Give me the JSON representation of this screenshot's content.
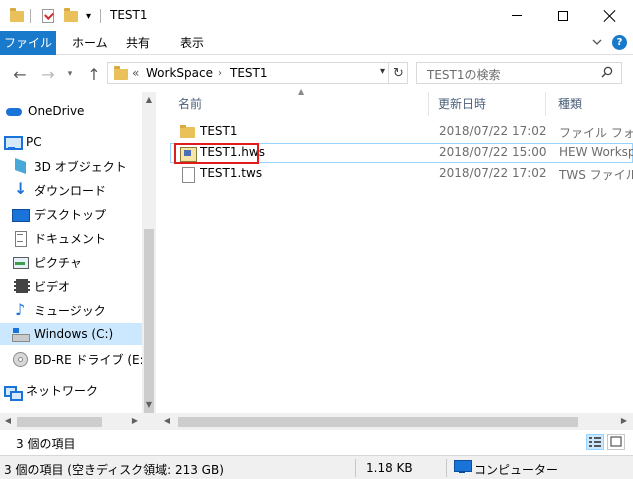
{
  "window": {
    "title": "TEST1"
  },
  "ribbon": {
    "tabs": [
      "ファイル",
      "ホーム",
      "共有",
      "表示"
    ]
  },
  "address": {
    "prefix": "«",
    "crumbs": [
      "WorkSpace",
      "TEST1"
    ]
  },
  "search": {
    "placeholder": "TEST1の検索"
  },
  "nav": {
    "items": [
      {
        "label": "OneDrive",
        "icon": "cloud-icon"
      },
      {
        "label": "PC",
        "icon": "pc-icon"
      },
      {
        "label": "3D オブジェクト",
        "icon": "cube-icon"
      },
      {
        "label": "ダウンロード",
        "icon": "download-icon"
      },
      {
        "label": "デスクトップ",
        "icon": "desktop-icon"
      },
      {
        "label": "ドキュメント",
        "icon": "document-icon"
      },
      {
        "label": "ピクチャ",
        "icon": "picture-icon"
      },
      {
        "label": "ビデオ",
        "icon": "video-icon"
      },
      {
        "label": "ミュージック",
        "icon": "music-icon"
      },
      {
        "label": "Windows (C:)",
        "icon": "drive-icon"
      },
      {
        "label": "BD-RE ドライブ (E:) AE",
        "icon": "disc-icon"
      },
      {
        "label": "ネットワーク",
        "icon": "network-icon"
      }
    ]
  },
  "columns": {
    "name": "名前",
    "modified": "更新日時",
    "type": "種類"
  },
  "files": [
    {
      "name": "TEST1",
      "modified": "2018/07/22 17:02",
      "type": "ファイル フォルダー",
      "icon": "folder-icon"
    },
    {
      "name": "TEST1.hws",
      "modified": "2018/07/22 15:00",
      "type": "HEW Workspace",
      "icon": "hws-file-icon"
    },
    {
      "name": "TEST1.tws",
      "modified": "2018/07/22 17:02",
      "type": "TWS ファイル",
      "icon": "document-icon"
    }
  ],
  "status": {
    "count": "3 個の項目",
    "detail": "3 個の項目 (空きディスク領域: 213 GB)",
    "size": "1.18 KB",
    "location": "コンピューター"
  },
  "colors": {
    "accent": "#1979ca",
    "selection": "#cce8ff",
    "highlight_box": "#e01b1b"
  }
}
